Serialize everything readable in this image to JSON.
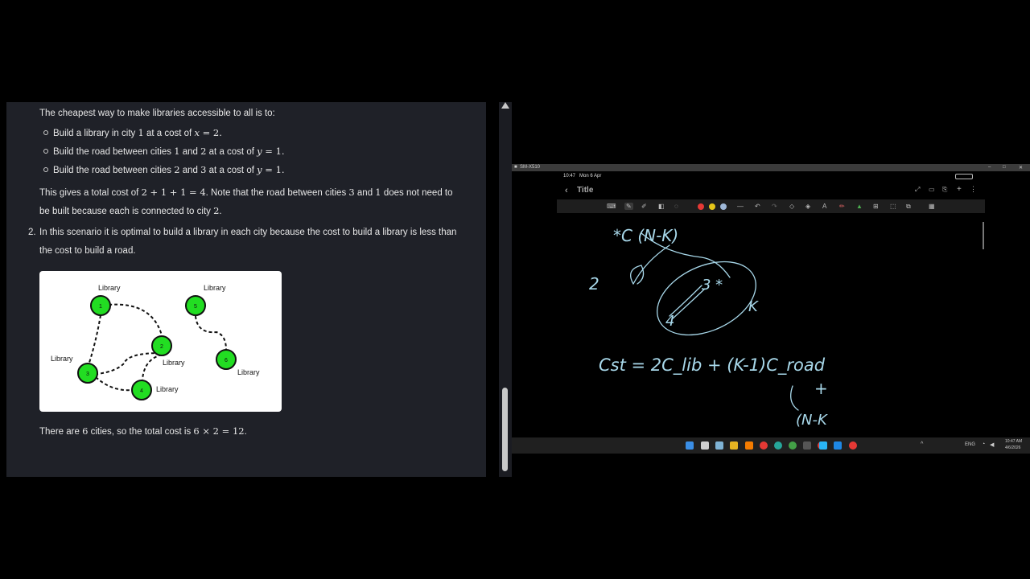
{
  "left_panel": {
    "intro": "The cheapest way to make libraries accessible to all is to:",
    "bullets": [
      {
        "pre": "Build a library in city ",
        "n1": "1",
        "mid": " at a cost of ",
        "var": "x",
        "eq": " = 2."
      },
      {
        "pre": "Build the road between cities ",
        "n1": "1",
        "and": " and ",
        "n2": "2",
        "mid": " at a cost of ",
        "var": "y",
        "eq": " = 1."
      },
      {
        "pre": "Build the road between cities ",
        "n1": "2",
        "and": " and ",
        "n2": "3",
        "mid": " at a cost of ",
        "var": "y",
        "eq": " = 1."
      }
    ],
    "total_a": "This gives a total cost of ",
    "total_math": "2 + 1 + 1 = 4",
    "total_b": ". Note that the road between cities ",
    "total_n1": "3",
    "total_and": " and ",
    "total_n2": "1",
    "total_c": " does not need to",
    "total_d": "be built because each is connected to city ",
    "total_n3": "2",
    "total_e": ".",
    "item2_num": "2.",
    "item2_line1": "In this scenario it is optimal to build a library in each city because the cost to build a library is less than",
    "item2_line2": "the cost to build a road.",
    "graph": {
      "library_label": "Library",
      "nodes": [
        "1",
        "2",
        "3",
        "4",
        "5",
        "6"
      ],
      "node_color": "#22dd22"
    },
    "final_a": "There are ",
    "final_n": "6",
    "final_b": " cities, so the total cost is ",
    "final_math": "6 × 2 = 12",
    "final_c": "."
  },
  "window": {
    "title": "SM-X510",
    "min": "–",
    "max": "□",
    "close": "✕",
    "status_time": "10:47",
    "status_date": "Mon 6 Apr",
    "note_title": "Title",
    "back_icon": "chevron-left-icon",
    "colors": [
      "#e53935",
      "#e6c619",
      "#9fb8d8"
    ],
    "handwriting": {
      "top": "*C (N-K)",
      "node2": "2",
      "node3": "3 *",
      "node4": "4",
      "k": "K",
      "cost": "Cst = 2C_lib + (K-1)C_road",
      "plus": "+",
      "nk": "(N-K"
    },
    "taskbar_lang": "ENG",
    "taskbar_time": "10:47 AM",
    "taskbar_date": "4/6/2026",
    "ink_color": "#a8d8ea"
  }
}
